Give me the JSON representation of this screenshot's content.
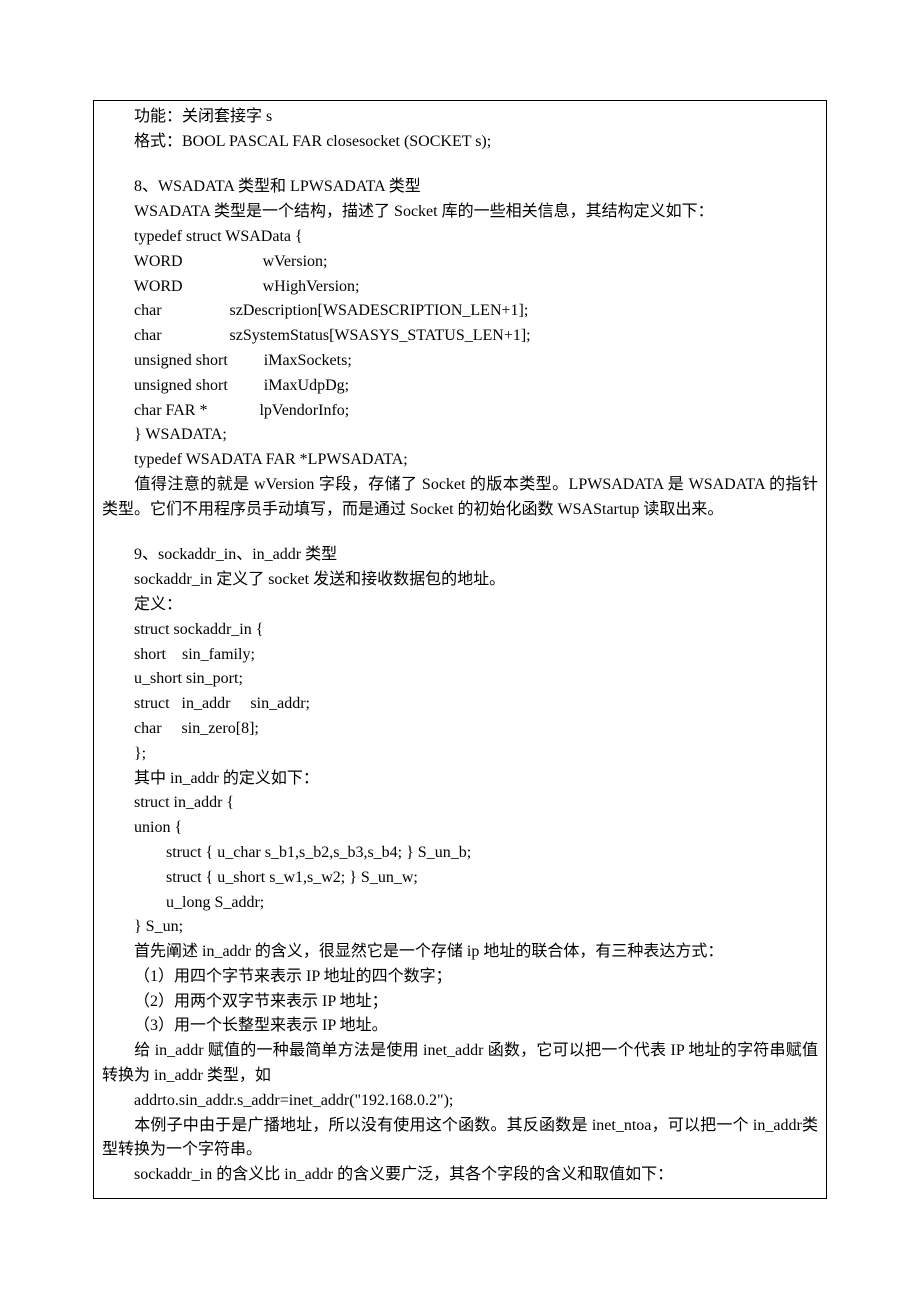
{
  "lines": {
    "l1": "功能：关闭套接字 s",
    "l2": "格式：BOOL PASCAL FAR closesocket (SOCKET s);",
    "l3": "8、WSADATA 类型和 LPWSADATA 类型",
    "l4": "WSADATA 类型是一个结构，描述了 Socket 库的一些相关信息，其结构定义如下：",
    "l5": "typedef struct WSAData {",
    "l6": "        WORD                    wVersion;\n        WORD                    wHighVersion;\n        char                 szDescription[WSADESCRIPTION_LEN+1];\n        char                 szSystemStatus[WSASYS_STATUS_LEN+1];\n        unsigned short         iMaxSockets;\n        unsigned short         iMaxUdpDg;\n        char FAR *             lpVendorInfo;",
    "l7": "} WSADATA;",
    "l8": "typedef WSADATA FAR *LPWSADATA;",
    "l9": "值得注意的就是 wVersion 字段，存储了 Socket 的版本类型。LPWSADATA 是 WSADATA 的指针类型。它们不用程序员手动填写，而是通过 Socket 的初始化函数 WSAStartup 读取出来。",
    "l10": "9、sockaddr_in、in_addr 类型",
    "l11": "sockaddr_in 定义了 socket 发送和接收数据包的地址。",
    "l12": "定义：",
    "l13": "struct sockaddr_in {",
    "l14": "        short    sin_family;\n        u_short sin_port;\n        struct   in_addr     sin_addr;\n        char     sin_zero[8];",
    "l15": "};",
    "l16": "其中 in_addr 的定义如下：",
    "l17": "struct in_addr {",
    "l18": "        union {\n                struct { u_char s_b1,s_b2,s_b3,s_b4; } S_un_b;\n                struct { u_short s_w1,s_w2; } S_un_w;\n                u_long S_addr;\n        } S_un;",
    "l19": "首先阐述 in_addr 的含义，很显然它是一个存储 ip 地址的联合体，有三种表达方式：",
    "l20": "（1）用四个字节来表示 IP 地址的四个数字；",
    "l21": "（2）用两个双字节来表示 IP 地址；",
    "l22": "（3）用一个长整型来表示 IP 地址。",
    "l23": "给 in_addr 赋值的一种最简单方法是使用 inet_addr 函数，它可以把一个代表 IP 地址的字符串赋值转换为 in_addr 类型，如",
    "l24": "addrto.sin_addr.s_addr=inet_addr(\"192.168.0.2\");",
    "l25": "本例子中由于是广播地址，所以没有使用这个函数。其反函数是 inet_ntoa，可以把一个 in_addr类型转换为一个字符串。",
    "l26": "sockaddr_in 的含义比 in_addr 的含义要广泛，其各个字段的含义和取值如下："
  }
}
